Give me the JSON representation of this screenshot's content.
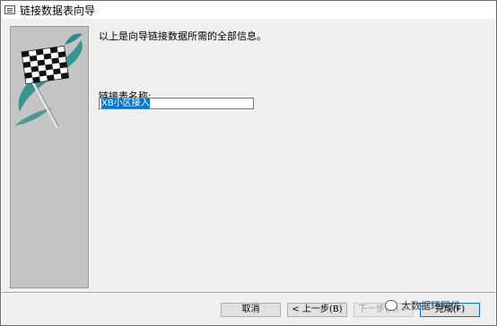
{
  "window": {
    "title": "链接数据表向导"
  },
  "content": {
    "description": "以上是向导链接数据所需的全部信息。",
    "table_name_label": "链接表名称:",
    "table_name_value": "XB小区接入"
  },
  "buttons": {
    "cancel": "取消",
    "back": "< 上一步(B)",
    "next": "下一步(N) >",
    "finish": "完成(F)"
  },
  "watermark": {
    "text": "大数据环网优"
  },
  "colors": {
    "client_bg": "#f0f0f0",
    "panel_bg": "#c4c4c4",
    "accent": "#0078d7",
    "flag_swirl": "#2a8f8a"
  },
  "icons": {
    "title": "table-wizard-icon",
    "art": "checkered-flag-icon"
  }
}
